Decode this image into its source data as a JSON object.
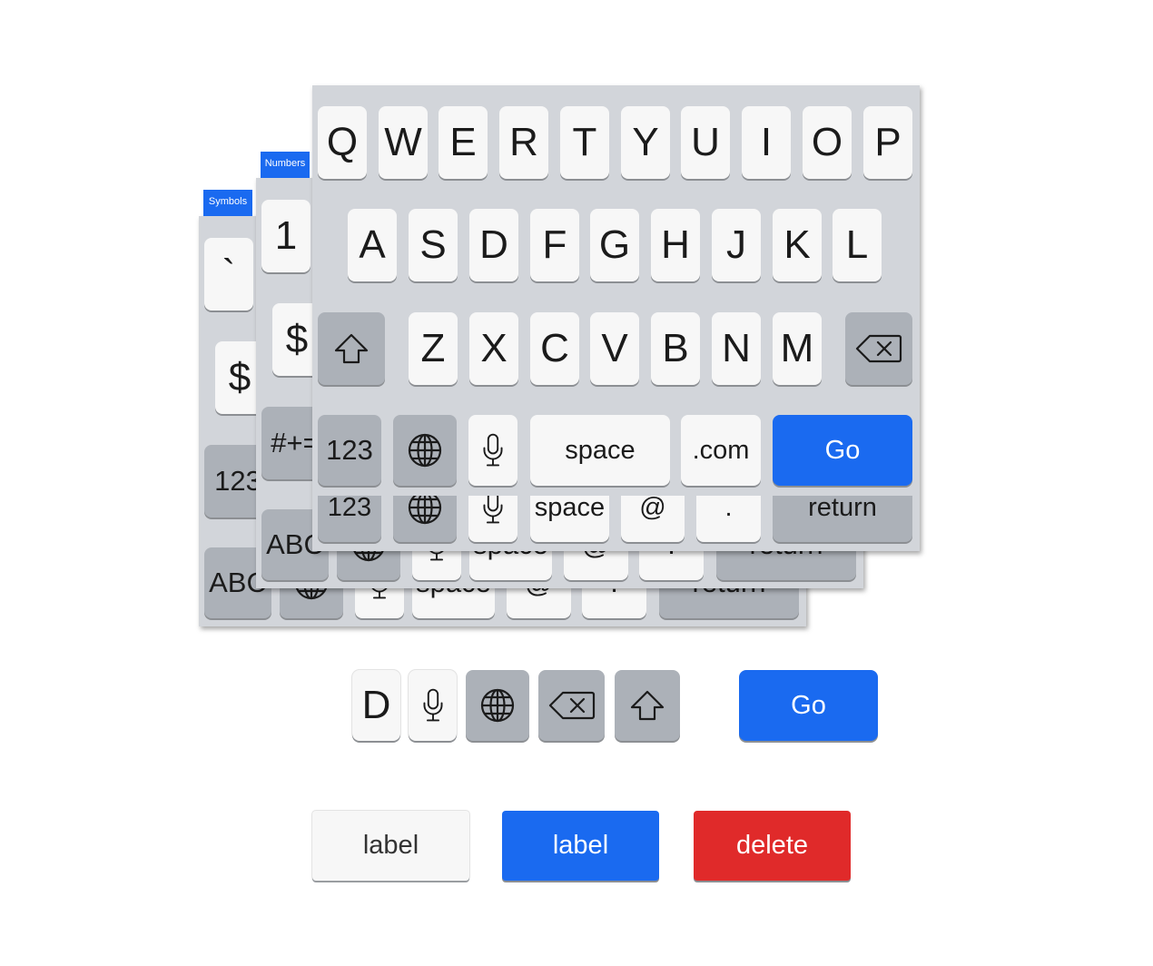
{
  "colors": {
    "accent": "#1a6af0",
    "danger": "#e02a2a",
    "keyboard_bg": "#d2d5da",
    "key_light": "#f7f7f7",
    "key_dark": "#acb1b8"
  },
  "symbols_keyboard": {
    "tag": "Symbols",
    "keys": [
      "`",
      "$",
      "123",
      "ABC",
      "space",
      "@",
      ".",
      "return"
    ]
  },
  "numbers_keyboard": {
    "tag": "Numbers",
    "keys": [
      "1",
      "$",
      "#+=",
      "ABC",
      "space",
      "@",
      ".",
      "return"
    ],
    "bottom_row": [
      "123",
      "space",
      "@",
      ".",
      "return"
    ]
  },
  "letters_keyboard": {
    "row1": [
      "Q",
      "W",
      "E",
      "R",
      "T",
      "Y",
      "U",
      "I",
      "O",
      "P"
    ],
    "row2": [
      "A",
      "S",
      "D",
      "F",
      "G",
      "H",
      "J",
      "K",
      "L"
    ],
    "row3": [
      "Z",
      "X",
      "C",
      "V",
      "B",
      "N",
      "M"
    ],
    "row4": {
      "numbers": "123",
      "globe_icon": "globe-icon",
      "mic_icon": "microphone-icon",
      "space": "space",
      "dotcom": ".com",
      "go": "Go"
    },
    "shift_icon": "shift-arrow-icon",
    "delete_icon": "backspace-icon"
  },
  "components": {
    "letter_key": "D",
    "mic_icon": "microphone-icon",
    "globe_icon": "globe-icon",
    "delete_icon": "backspace-icon",
    "shift_icon": "shift-arrow-icon",
    "go_button": "Go"
  },
  "buttons": {
    "label_light": "label",
    "label_blue": "label",
    "delete": "delete"
  }
}
